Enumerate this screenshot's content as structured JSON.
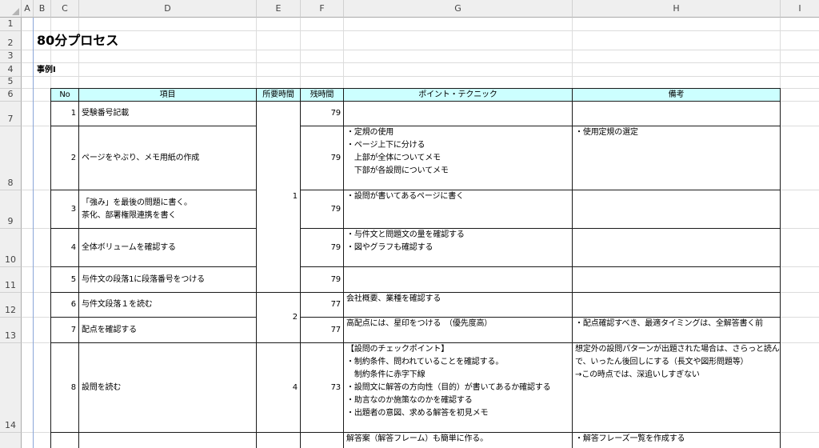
{
  "sheet": {
    "column_headers": [
      "A",
      "B",
      "C",
      "D",
      "E",
      "F",
      "G",
      "H",
      "I"
    ],
    "row_headers": [
      "1",
      "2",
      "3",
      "4",
      "5",
      "6",
      "7",
      "8",
      "9",
      "10",
      "11",
      "12",
      "13",
      "14"
    ],
    "header_fill": "#ccffff"
  },
  "title": "80分プロセス",
  "subtitle": "事例Ⅰ",
  "table": {
    "headers": {
      "no": "No",
      "item": "項目",
      "required_time": "所要時間",
      "remaining_time": "残時間",
      "points": "ポイント・テクニック",
      "notes": "備考"
    },
    "required_time": [
      "1",
      "2",
      "4"
    ],
    "rows": [
      {
        "no": "1",
        "item": [
          "受験番号記載"
        ],
        "remaining": "79"
      },
      {
        "no": "2",
        "item": [
          "ページをやぶり、メモ用紙の作成"
        ],
        "remaining": "79",
        "points": [
          "・定規の使用",
          "・ページ上下に分ける",
          "　上部が全体についてメモ",
          "　下部が各設問についてメモ"
        ],
        "notes": [
          "・使用定規の選定"
        ]
      },
      {
        "no": "3",
        "item": [
          "「強み」を最後の問題に書く。",
          "茶化、部署権限連携を書く"
        ],
        "remaining": "79",
        "points": [
          "・設問が書いてあるページに書く"
        ]
      },
      {
        "no": "4",
        "item": [
          "全体ボリュームを確認する"
        ],
        "remaining": "79",
        "points": [
          "・与件文と問題文の量を確認する",
          "・図やグラフも確認する"
        ]
      },
      {
        "no": "5",
        "item": [
          "与件文の段落1に段落番号をつける"
        ],
        "remaining": "79"
      },
      {
        "no": "6",
        "item": [
          "与件文段落１を読む"
        ],
        "remaining": "77",
        "points": [
          "会社概要、業種を確認する"
        ]
      },
      {
        "no": "7",
        "item": [
          "配点を確認する"
        ],
        "remaining": "77",
        "points": [
          "高配点には、星印をつける　（優先度高）"
        ],
        "notes": [
          "・配点確認すべき、最適タイミングは、全解答書く前"
        ]
      },
      {
        "no": "8",
        "item": [
          "設問を読む"
        ],
        "remaining": "73",
        "points": [
          "【設問のチェックポイント】",
          "・制約条件、問われていることを確認する。",
          "　制約条件に赤字下線",
          "・設問文に解答の方向性（目的）が書いてあるか確認する",
          "・助言なのか施策なのかを確認する",
          "・出題者の意図、求める解答を初見メモ"
        ],
        "notes": [
          "想定外の設問パターンが出題された場合は、さらっと読ん",
          "で、いったん後回しにする（長文や図形問題等）",
          "→この時点では、深追いしすぎない"
        ]
      },
      {
        "points": [
          "解答案（解答フレーム）も簡単に作る。"
        ],
        "notes": [
          "・解答フレーズ一覧を作成する"
        ]
      }
    ]
  }
}
